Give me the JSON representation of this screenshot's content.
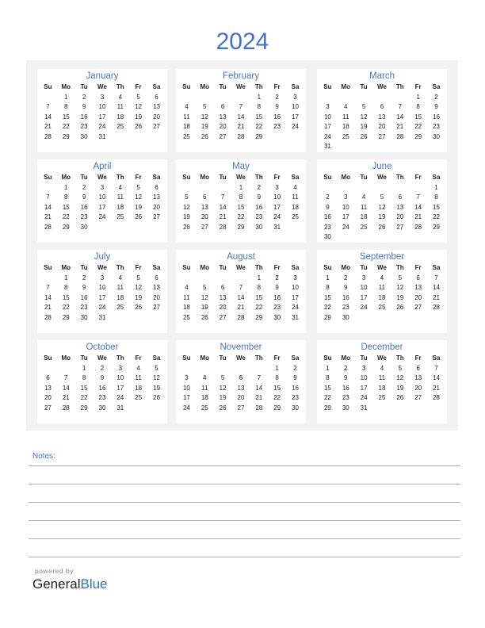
{
  "title": "2024",
  "weekdays": [
    "Su",
    "Mo",
    "Tu",
    "We",
    "Th",
    "Fr",
    "Sa"
  ],
  "months": [
    {
      "name": "January",
      "start": 1,
      "days": 31
    },
    {
      "name": "February",
      "start": 4,
      "days": 29
    },
    {
      "name": "March",
      "start": 5,
      "days": 31
    },
    {
      "name": "April",
      "start": 1,
      "days": 30
    },
    {
      "name": "May",
      "start": 3,
      "days": 31
    },
    {
      "name": "June",
      "start": 6,
      "days": 30
    },
    {
      "name": "July",
      "start": 1,
      "days": 31
    },
    {
      "name": "August",
      "start": 4,
      "days": 31
    },
    {
      "name": "September",
      "start": 0,
      "days": 30
    },
    {
      "name": "October",
      "start": 2,
      "days": 31
    },
    {
      "name": "November",
      "start": 5,
      "days": 30
    },
    {
      "name": "December",
      "start": 0,
      "days": 31
    }
  ],
  "notes": {
    "label": "Notes:"
  },
  "footer": {
    "powered_by": "powered by",
    "brand_general": "General",
    "brand_blue": "Blue"
  }
}
